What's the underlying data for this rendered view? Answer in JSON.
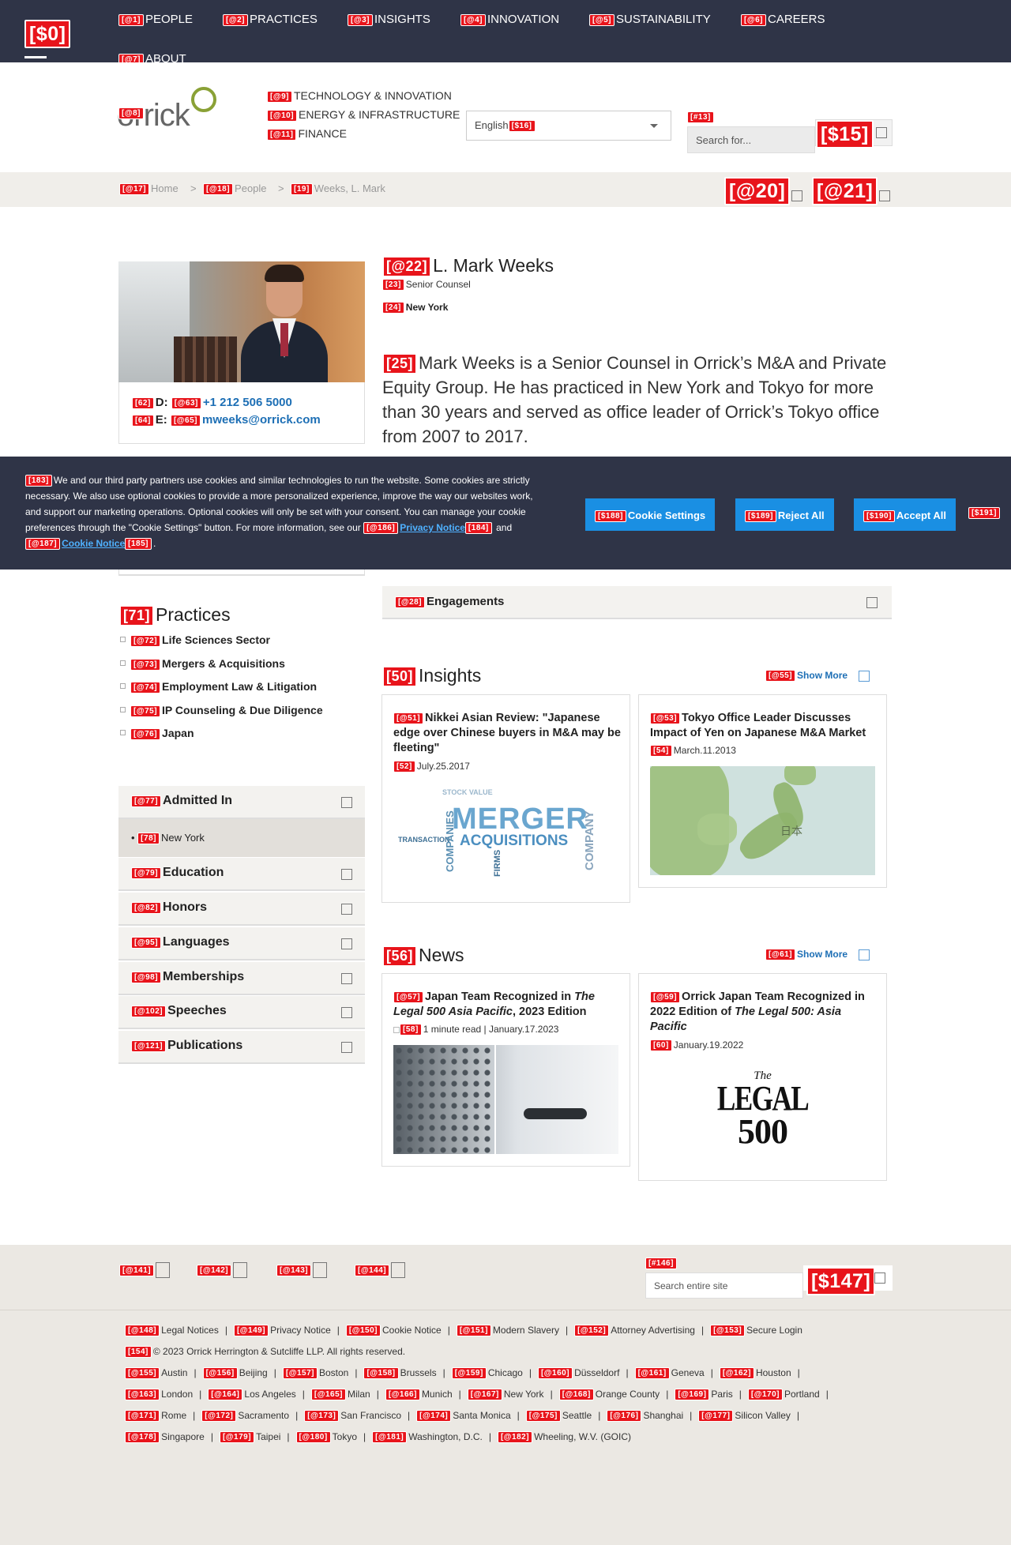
{
  "topnav": {
    "home_tag": "[$0]",
    "items": [
      {
        "tag": "[@1]",
        "label": "PEOPLE"
      },
      {
        "tag": "[@2]",
        "label": "PRACTICES"
      },
      {
        "tag": "[@3]",
        "label": "INSIGHTS"
      },
      {
        "tag": "[@4]",
        "label": "INNOVATION"
      },
      {
        "tag": "[@5]",
        "label": "SUSTAINABILITY"
      },
      {
        "tag": "[@6]",
        "label": "CAREERS"
      },
      {
        "tag": "[@7]",
        "label": "ABOUT"
      }
    ]
  },
  "header": {
    "logo_tag": "[@8]",
    "logo_text": "orrick",
    "subnav": [
      {
        "tag": "[@9]",
        "label": "TECHNOLOGY & INNOVATION"
      },
      {
        "tag": "[@10]",
        "label": "ENERGY & INFRASTRUCTURE"
      },
      {
        "tag": "[@11]",
        "label": "FINANCE"
      }
    ],
    "language": {
      "value": "English",
      "tag": "[$16]"
    },
    "search": {
      "tag": "[#13]",
      "placeholder": "Search for..."
    },
    "search_btn_tag": "[$15]"
  },
  "breadcrumb": {
    "items": [
      {
        "tag": "[@17]",
        "label": "Home"
      },
      {
        "tag": "[@18]",
        "label": "People"
      },
      {
        "tag": "[19]",
        "label": "Weeks, L. Mark"
      }
    ],
    "sep": ">",
    "btn1_tag": "[@20]",
    "btn2_tag": "[@21]"
  },
  "profile": {
    "name_tag": "[@22]",
    "name": "L. Mark Weeks",
    "title_tag": "[23]",
    "title": "Senior Counsel",
    "office_tag": "[24]",
    "office": "New York",
    "bio_tag": "[25]",
    "bio": "Mark Weeks is a Senior Counsel in Orrick’s M&A and Private Equity Group. He has practiced in New York and Tokyo for more than 30 years and served as office leader of Orrick’s Tokyo office from 2007 to 2017.",
    "phone_label_tag": "[62]",
    "phone_label": "D:",
    "phone_tag": "[@63]",
    "phone": "+1 212 506 5000",
    "email_label_tag": "[64]",
    "email_label": "E:",
    "email_tag": "[@65]",
    "email": "mweeks@orrick.com"
  },
  "cookie": {
    "tag": "[183]",
    "text": "We and our third party partners use cookies and similar technologies to run the website. Some cookies are strictly necessary. We also use optional cookies to provide a more personalized experience, improve the way our websites work, and support our marketing operations. Optional cookies will only be set with your consent. You can manage your cookie preferences through the \"Cookie Settings\" button. For more information, see our",
    "privacy_tag": "[@186]",
    "privacy_label": "Privacy Notice",
    "privacy_tag2": "[184]",
    "and": "and",
    "cookie_tag": "[@187]",
    "cookie_label": "Cookie Notice",
    "cookie_tag2": "[185]",
    "end": ".",
    "settings": {
      "tag": "[$188]",
      "label": "Cookie Settings"
    },
    "reject": {
      "tag": "[$189]",
      "label": "Reject All"
    },
    "accept": {
      "tag": "[$190]",
      "label": "Accept All"
    },
    "close_tag": "[$191]"
  },
  "engagements": {
    "tag": "[@28]",
    "label": "Engagements"
  },
  "practices": {
    "tag": "[71]",
    "heading": "Practices",
    "items": [
      {
        "tag": "[@72]",
        "label": "Life Sciences Sector"
      },
      {
        "tag": "[@73]",
        "label": "Mergers & Acquisitions"
      },
      {
        "tag": "[@74]",
        "label": "Employment Law & Litigation"
      },
      {
        "tag": "[@75]",
        "label": "IP Counseling & Due Diligence"
      },
      {
        "tag": "[@76]",
        "label": "Japan"
      }
    ]
  },
  "accordion": [
    {
      "tag": "[@77]",
      "label": "Admitted In"
    },
    {
      "tag": "[@79]",
      "label": "Education"
    },
    {
      "tag": "[@82]",
      "label": "Honors"
    },
    {
      "tag": "[@95]",
      "label": "Languages"
    },
    {
      "tag": "[@98]",
      "label": "Memberships"
    },
    {
      "tag": "[@102]",
      "label": "Speeches"
    },
    {
      "tag": "[@121]",
      "label": "Publications"
    }
  ],
  "admitted": {
    "tag": "[78]",
    "value": "New York"
  },
  "insights": {
    "tag": "[50]",
    "heading": "Insights",
    "more_tag": "[@55]",
    "more": "Show More",
    "cards": [
      {
        "tag": "[@51]",
        "title": "Nikkei Asian Review: \"Japanese edge over Chinese buyers in M&A may be fleeting\"",
        "date_tag": "[52]",
        "date": "July.25.2017"
      },
      {
        "tag": "[@53]",
        "title": "Tokyo Office Leader Discusses Impact of Yen on Japanese M&A Market",
        "date_tag": "[54]",
        "date": "March.11.2013"
      }
    ],
    "wordcloud": {
      "w1": "MERGER",
      "w2": "ACQUISITIONS",
      "w3": "TRANSACTION",
      "w4": "COMPANY",
      "w5": "STOCK VALUE",
      "w6": "COMPANIES",
      "w7": "FIRMS"
    },
    "map_label": "日本"
  },
  "news": {
    "tag": "[56]",
    "heading": "News",
    "more_tag": "[@61]",
    "more": "Show More",
    "cards": [
      {
        "tag": "[@57]",
        "title_a": "Japan Team Recognized in ",
        "title_i": "The Legal 500 Asia Pacific",
        "title_b": ", 2023 Edition",
        "date_tag": "[58]",
        "date": "1 minute read | January.17.2023"
      },
      {
        "tag": "[@59]",
        "title_a": "Orrick Japan Team Recognized in 2022 Edition of ",
        "title_i": "The Legal 500: Asia Pacific",
        "title_b": "",
        "date_tag": "[60]",
        "date": "January.19.2022"
      }
    ],
    "legal_the": "The",
    "legal_word": "LEGAL",
    "legal_num": "500"
  },
  "footer": {
    "social_tags": [
      "[@141]",
      "[@142]",
      "[@143]",
      "[@144]"
    ],
    "search": {
      "tag": "[#146]",
      "placeholder": "Search entire site"
    },
    "search_btn_tag": "[$147]",
    "links": [
      {
        "tag": "[@148]",
        "label": "Legal Notices"
      },
      {
        "tag": "[@149]",
        "label": "Privacy Notice"
      },
      {
        "tag": "[@150]",
        "label": "Cookie Notice"
      },
      {
        "tag": "[@151]",
        "label": "Modern Slavery"
      },
      {
        "tag": "[@152]",
        "label": "Attorney Advertising"
      },
      {
        "tag": "[@153]",
        "label": "Secure Login"
      }
    ],
    "copyright_tag": "[154]",
    "copyright": "© 2023 Orrick Herrington & Sutcliffe LLP. All rights reserved.",
    "offices": [
      [
        {
          "tag": "[@155]",
          "label": "Austin"
        },
        {
          "tag": "[@156]",
          "label": "Beijing"
        },
        {
          "tag": "[@157]",
          "label": "Boston"
        },
        {
          "tag": "[@158]",
          "label": "Brussels"
        },
        {
          "tag": "[@159]",
          "label": "Chicago"
        },
        {
          "tag": "[@160]",
          "label": "Düsseldorf"
        },
        {
          "tag": "[@161]",
          "label": "Geneva"
        },
        {
          "tag": "[@162]",
          "label": "Houston"
        }
      ],
      [
        {
          "tag": "[@163]",
          "label": "London"
        },
        {
          "tag": "[@164]",
          "label": "Los Angeles"
        },
        {
          "tag": "[@165]",
          "label": "Milan"
        },
        {
          "tag": "[@166]",
          "label": "Munich"
        },
        {
          "tag": "[@167]",
          "label": "New York"
        },
        {
          "tag": "[@168]",
          "label": "Orange County"
        },
        {
          "tag": "[@169]",
          "label": "Paris"
        },
        {
          "tag": "[@170]",
          "label": "Portland"
        }
      ],
      [
        {
          "tag": "[@171]",
          "label": "Rome"
        },
        {
          "tag": "[@172]",
          "label": "Sacramento"
        },
        {
          "tag": "[@173]",
          "label": "San Francisco"
        },
        {
          "tag": "[@174]",
          "label": "Santa Monica"
        },
        {
          "tag": "[@175]",
          "label": "Seattle"
        },
        {
          "tag": "[@176]",
          "label": "Shanghai"
        },
        {
          "tag": "[@177]",
          "label": "Silicon Valley"
        }
      ],
      [
        {
          "tag": "[@178]",
          "label": "Singapore"
        },
        {
          "tag": "[@179]",
          "label": "Taipei"
        },
        {
          "tag": "[@180]",
          "label": "Tokyo"
        },
        {
          "tag": "[@181]",
          "label": "Washington, D.C."
        },
        {
          "tag": "[@182]",
          "label": "Wheeling, W.V. (GOIC)"
        }
      ]
    ]
  },
  "colors": {
    "nav_bg": "#2f3447",
    "accent_blue": "#1d6fb5",
    "cookie_btn": "#1a8fe3",
    "badge_red": "#e8141b",
    "logo_green": "#8aa136"
  }
}
